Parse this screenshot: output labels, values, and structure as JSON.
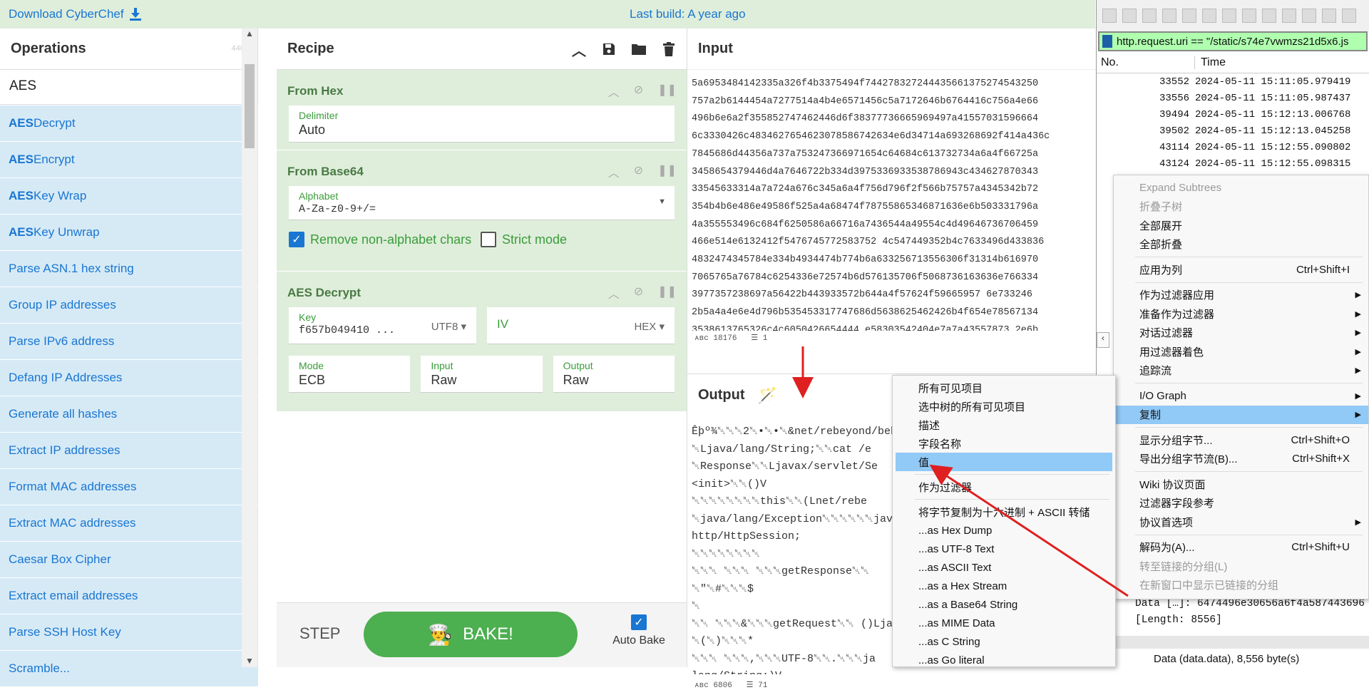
{
  "top": {
    "download": "Download CyberChef",
    "last_build": "Last build: A year ago"
  },
  "ops": {
    "title": "Operations",
    "count": "440",
    "search": "AES",
    "items": [
      {
        "pre": "AES",
        "post": " Decrypt"
      },
      {
        "pre": "AES",
        "post": " Encrypt"
      },
      {
        "pre": "AES",
        "post": " Key Wrap"
      },
      {
        "pre": "AES",
        "post": " Key Unwrap"
      },
      {
        "pre": "",
        "post": "Parse ASN.1 hex string"
      },
      {
        "pre": "",
        "post": "Group IP addresses"
      },
      {
        "pre": "",
        "post": "Parse IPv6 address"
      },
      {
        "pre": "",
        "post": "Defang IP Addresses"
      },
      {
        "pre": "",
        "post": "Generate all hashes"
      },
      {
        "pre": "",
        "post": "Extract IP addresses"
      },
      {
        "pre": "",
        "post": "Format MAC addresses"
      },
      {
        "pre": "",
        "post": "Extract MAC addresses"
      },
      {
        "pre": "",
        "post": "Caesar Box Cipher"
      },
      {
        "pre": "",
        "post": "Extract email addresses"
      },
      {
        "pre": "",
        "post": "Parse SSH Host Key"
      },
      {
        "pre": "",
        "post": "Scramble..."
      }
    ]
  },
  "recipe": {
    "title": "Recipe",
    "from_hex": {
      "title": "From Hex",
      "delim_label": "Delimiter",
      "delim": "Auto"
    },
    "from_b64": {
      "title": "From Base64",
      "alpha_label": "Alphabet",
      "alpha": "A-Za-z0-9+/=",
      "remove": "Remove non-alphabet chars",
      "strict": "Strict mode"
    },
    "aes": {
      "title": "AES Decrypt",
      "key_label": "Key",
      "key": "f657b049410 ...",
      "key_enc": "UTF8",
      "iv_label": "IV",
      "iv_enc": "HEX",
      "mode_label": "Mode",
      "mode": "ECB",
      "in_label": "Input",
      "in": "Raw",
      "out_label": "Output",
      "out": "Raw"
    },
    "step": "STEP",
    "bake": "BAKE!",
    "autobake": "Auto Bake"
  },
  "input": {
    "title": "Input",
    "len": "18176",
    "lines": "1",
    "lines_text": [
      "5a6953484142335a326f4b3375494f744278327244435661375274543250",
      "757a2b6144454a7277514a4b4e6571456c5a7172646b6764416c756a4e66",
      "496b6e6a2f355852747462446d6f38377736665969497a41557031596664",
      "6c3330426c4834627654623078586742634e6d34714a693268692f414a436c",
      "7845686d44356a737a753247366971654c64684c613732734a6a4f66725a",
      "3458654379446d4a7646722b334d3975336933538786943c434627870343",
      "33545633314a7a724a676c345a6a4f756d796f2f566b75757a4345342b72",
      "354b4b6e486e49586f525a4a68474f78755865346871636e6b503331796a",
      "4a355553496c684f6250586a66716a7436544a49554c4d49646736706459",
      "466e514e6132412f5476745772583752 4c547449352b4c7633496d433836",
      "4832474345784e334b4934474b774b6a633256713556306f31314b616970",
      "7065765a76784c6254336e72574b6d576135706f5068736163636e766334",
      "3977357238697a56422b443933572b644a4f57624f59665957 6e733246",
      "2b5a4a4e6e4d796b535453317747686d5638625462426b4f654e78567134",
      "3538613765326c4c6050426654444 e58303542404e7a7a43557873 2e6b"
    ]
  },
  "output": {
    "title": "Output",
    "len": "6806",
    "lines": "71",
    "lines_text": [
      "Êþº¾␀␀␀2␀•␀•␀&net/rebeyond/beh",
      "␀Ljava/lang/String;␀␀cat /e",
      "␀Response␀␀Ljavax/servlet/Se",
      "<init>␀␀()V",
      "␀␀␀␀␀␀␀␀this␀␀(Lnet/rebe",
      "␀java/lang/Exception␀␀␀␀␀␀jav",
      "http/HttpSession;",
      "␀␀␀␀␀␀␀␀",
      "␀␀␀   ␀␀␀ ␀␀␀getResponse␀␀",
      "␀\"␀#␀␀␀$",
      "␀",
      "␀␀  ␀␀␀&␀␀␀getRequest␀␀ ()Lja",
      "␀(␀)␀␀␀*",
      "␀␀␀    ␀␀␀,␀␀␀UTF-8␀␀.␀␀␀ja",
      "lang/String;)V"
    ]
  },
  "ws": {
    "filter": "http.request.uri == \"/static/s74e7vwmzs21d5x6.js",
    "col_no": "No.",
    "col_time": "Time",
    "packets": [
      {
        "no": "33552",
        "time": "2024-05-11 15:11:05.979419"
      },
      {
        "no": "33556",
        "time": "2024-05-11 15:11:05.987437"
      },
      {
        "no": "39494",
        "time": "2024-05-11 15:12:13.006768"
      },
      {
        "no": "39502",
        "time": "2024-05-11 15:12:13.045258"
      },
      {
        "no": "43114",
        "time": "2024-05-11 15:12:55.090802"
      },
      {
        "no": "43124",
        "time": "2024-05-11 15:12:55.098315"
      }
    ],
    "detail1": "Data […]: 6474496e30656a6f4a587443696",
    "detail2": "[Length: 8556]",
    "status": "Data (data.data), 8,556 byte(s)"
  },
  "menu1": [
    {
      "t": "Expand Subtrees",
      "dis": true
    },
    {
      "t": "折叠子树",
      "dis": true
    },
    {
      "t": "全部展开"
    },
    {
      "t": "全部折叠"
    },
    {
      "sep": true
    },
    {
      "t": "应用为列",
      "sc": "Ctrl+Shift+I"
    },
    {
      "sep": true
    },
    {
      "t": "作为过滤器应用",
      "ar": true
    },
    {
      "t": "准备作为过滤器",
      "ar": true
    },
    {
      "t": "对话过滤器",
      "ar": true
    },
    {
      "t": "用过滤器着色",
      "ar": true
    },
    {
      "t": "追踪流",
      "ar": true
    },
    {
      "sep": true
    },
    {
      "t": "I/O Graph",
      "ar": true
    },
    {
      "t": "复制",
      "ar": true,
      "hl": true
    },
    {
      "sep": true
    },
    {
      "t": "显示分组字节...",
      "sc": "Ctrl+Shift+O"
    },
    {
      "t": "导出分组字节流(B)...",
      "sc": "Ctrl+Shift+X"
    },
    {
      "sep": true
    },
    {
      "t": "Wiki 协议页面"
    },
    {
      "t": "过滤器字段参考"
    },
    {
      "t": "协议首选项",
      "ar": true
    },
    {
      "sep": true
    },
    {
      "t": "解码为(A)...",
      "sc": "Ctrl+Shift+U"
    },
    {
      "t": "转至链接的分组(L)",
      "dis": true
    },
    {
      "t": "在新窗口中显示已链接的分组",
      "dis": true
    }
  ],
  "menu2": [
    {
      "t": "所有可见项目"
    },
    {
      "t": "选中树的所有可见项目"
    },
    {
      "t": "描述"
    },
    {
      "t": "字段名称"
    },
    {
      "t": "值",
      "hl": true
    },
    {
      "sep": true
    },
    {
      "t": "作为过滤器"
    },
    {
      "sep": true
    },
    {
      "t": "将字节复制为十六进制 + ASCII 转储"
    },
    {
      "t": "...as Hex Dump"
    },
    {
      "t": "...as UTF-8 Text"
    },
    {
      "t": "...as ASCII Text"
    },
    {
      "t": "...as a Hex Stream"
    },
    {
      "t": "...as a Base64 String"
    },
    {
      "t": "...as MIME Data"
    },
    {
      "t": "...as C String"
    },
    {
      "t": "...as Go literal"
    }
  ],
  "colors": {
    "accent": "#1976d2",
    "green": "#4caf50",
    "arrow": "#e02020"
  }
}
